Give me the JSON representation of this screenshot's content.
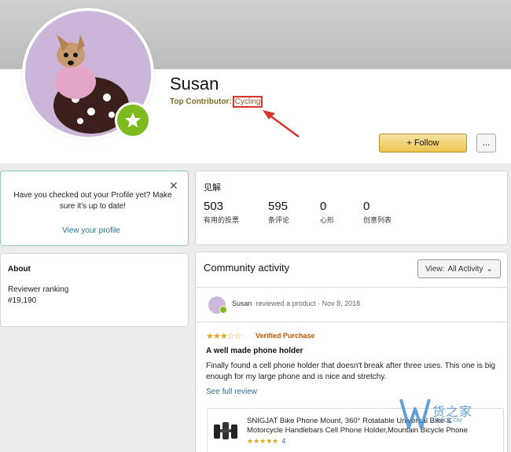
{
  "profile": {
    "name": "Susan",
    "contributor_label": "Top Contributor:",
    "contributor_topic": "Cycling",
    "follow_label": "+ Follow",
    "more_label": "..."
  },
  "prompt_card": {
    "text": "Have you checked out your Profile yet? Make sure it's up to date!",
    "close_icon": "close-icon",
    "link": "View your profile"
  },
  "about": {
    "title": "About",
    "ranking_label": "Reviewer ranking",
    "ranking_value": "#19,190"
  },
  "insights": {
    "title": "见解",
    "stats": [
      {
        "value": "503",
        "label": "有用的投票"
      },
      {
        "value": "595",
        "label": "条评论"
      },
      {
        "value": "0",
        "label": "心形"
      },
      {
        "value": "0",
        "label": "创意列表"
      }
    ]
  },
  "community": {
    "title": "Community activity",
    "view_label": "View:",
    "view_value": "All Activity",
    "activity": {
      "user": "Susan",
      "action": "reviewed a product",
      "date": "· Nov 8, 2018",
      "rating": 3,
      "rating_stars": "★★★☆☆",
      "verified": "Verified Purchase",
      "review_title": "A well made phone holder",
      "review_body": "Finally found a cell phone holder that doesn't break after three uses. This one is big enough for my large phone and is nice and stretchy.",
      "see_full": "See full review",
      "product": {
        "title": "SNIGJAT Bike Phone Mount, 360° Rotatable Universal Bike & Motorcycle Handlebars Cell Phone Holder,Mountain Bicycle Phone",
        "rating_stars": "★★★★★",
        "rating_count": "4"
      }
    }
  },
  "watermark": {
    "text": "货之家",
    "sub": "W2C.COM"
  },
  "colors": {
    "badge_green": "#7fbb1f",
    "follow_yellow": "#efc54e",
    "link_blue": "#2b6e95",
    "highlight_red": "#d9342b",
    "verified_orange": "#c45500"
  }
}
